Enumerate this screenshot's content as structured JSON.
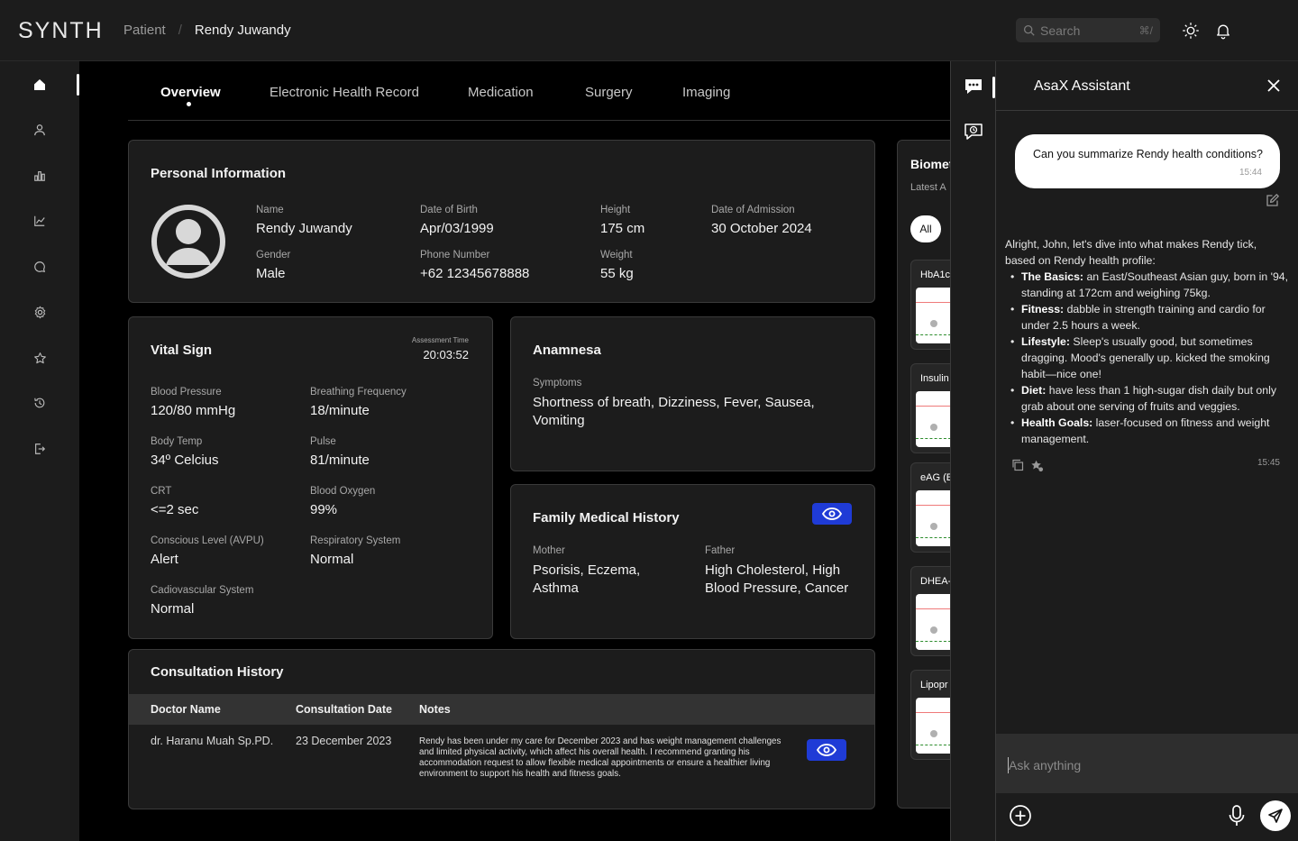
{
  "app": {
    "logo": "SYNTH"
  },
  "breadcrumb": {
    "root": "Patient",
    "separator": "/",
    "current": "Rendy Juwandy"
  },
  "search": {
    "placeholder": "Search",
    "shortcut": "⌘/"
  },
  "tabs": [
    {
      "label": "Overview",
      "active": true
    },
    {
      "label": "Electronic Health Record"
    },
    {
      "label": "Medication"
    },
    {
      "label": "Surgery"
    },
    {
      "label": "Imaging"
    }
  ],
  "personal": {
    "title": "Personal Information",
    "name_label": "Name",
    "name": "Rendy Juwandy",
    "gender_label": "Gender",
    "gender": "Male",
    "dob_label": "Date of Birth",
    "dob": "Apr/03/1999",
    "phone_label": "Phone Number",
    "phone": "+62 12345678888",
    "height_label": "Height",
    "height": "175 cm",
    "weight_label": "Weight",
    "weight": "55 kg",
    "admission_label": "Date of Admission",
    "admission": "30 October 2024"
  },
  "vital": {
    "title": "Vital Sign",
    "assessment_label": "Assessment Time",
    "assessment_time": "20:03:52",
    "items": [
      {
        "label": "Blood Pressure",
        "value": "120/80 mmHg"
      },
      {
        "label": "Breathing Frequency",
        "value": "18/minute"
      },
      {
        "label": "Body Temp",
        "value": "34º Celcius"
      },
      {
        "label": "Pulse",
        "value": "81/minute"
      },
      {
        "label": "CRT",
        "value": "<=2 sec"
      },
      {
        "label": "Blood Oxygen",
        "value": "99%"
      },
      {
        "label": "Conscious Level (AVPU)",
        "value": "Alert"
      },
      {
        "label": "Respiratory System",
        "value": "Normal"
      },
      {
        "label": "Cadiovascular System",
        "value": "Normal"
      }
    ]
  },
  "anamnesa": {
    "title": "Anamnesa",
    "symptoms_label": "Symptoms",
    "symptoms_line1": "Shortness of breath, Dizziness, Fever, Sausea,",
    "symptoms_line2": "Vomiting"
  },
  "family": {
    "title": "Family Medical History",
    "mother_label": "Mother",
    "mother_line1": "Psorisis, Eczema,",
    "mother_line2": "Asthma",
    "father_label": "Father",
    "father_line1": "High Cholesterol, High",
    "father_line2": "Blood Pressure, Cancer"
  },
  "consultation": {
    "title": "Consultation History",
    "columns": [
      "Doctor Name",
      "Consultation Date",
      "Notes"
    ],
    "rows": [
      {
        "doctor": "dr. Haranu Muah Sp.PD.",
        "date": "23 December 2023",
        "notes": "Rendy has been under my care for December 2023 and has weight management challenges and limited physical activity, which affect his overall health. I recommend granting his accommodation request to allow flexible medical appointments or ensure a healthier living environment to support his health and fitness goals."
      }
    ]
  },
  "biometric": {
    "title": "Biomet",
    "subtitle": "Latest A",
    "filter_all": "All",
    "items": [
      "HbA1c",
      "Insulin",
      "eAG (E",
      "DHEA-",
      "Lipopr"
    ]
  },
  "assistant": {
    "title": "AsaX Assistant",
    "question": "Can you summarize Rendy health conditions?",
    "question_time": "15:44",
    "intro": "Alright, John, let's dive into what makes Rendy tick, based on Rendy health profile:",
    "points": [
      {
        "head": "The Basics:",
        "text": " an East/Southeast Asian guy, born in '94, standing at 172cm and weighing 75kg."
      },
      {
        "head": "Fitness:",
        "text": " dabble in strength training and cardio for under 2.5 hours a week."
      },
      {
        "head": "Lifestyle:",
        "text": " Sleep's usually good, but sometimes dragging. Mood's generally up. kicked the smoking habit—nice one!"
      },
      {
        "head": "Diet:",
        "text": " have less than 1 high-sugar dish daily but only grab about one serving of fruits and veggies."
      },
      {
        "head": "Health Goals:",
        "text": " laser-focused on fitness and weight management."
      }
    ],
    "reply_time": "15:45",
    "input_placeholder": "Ask anything"
  }
}
